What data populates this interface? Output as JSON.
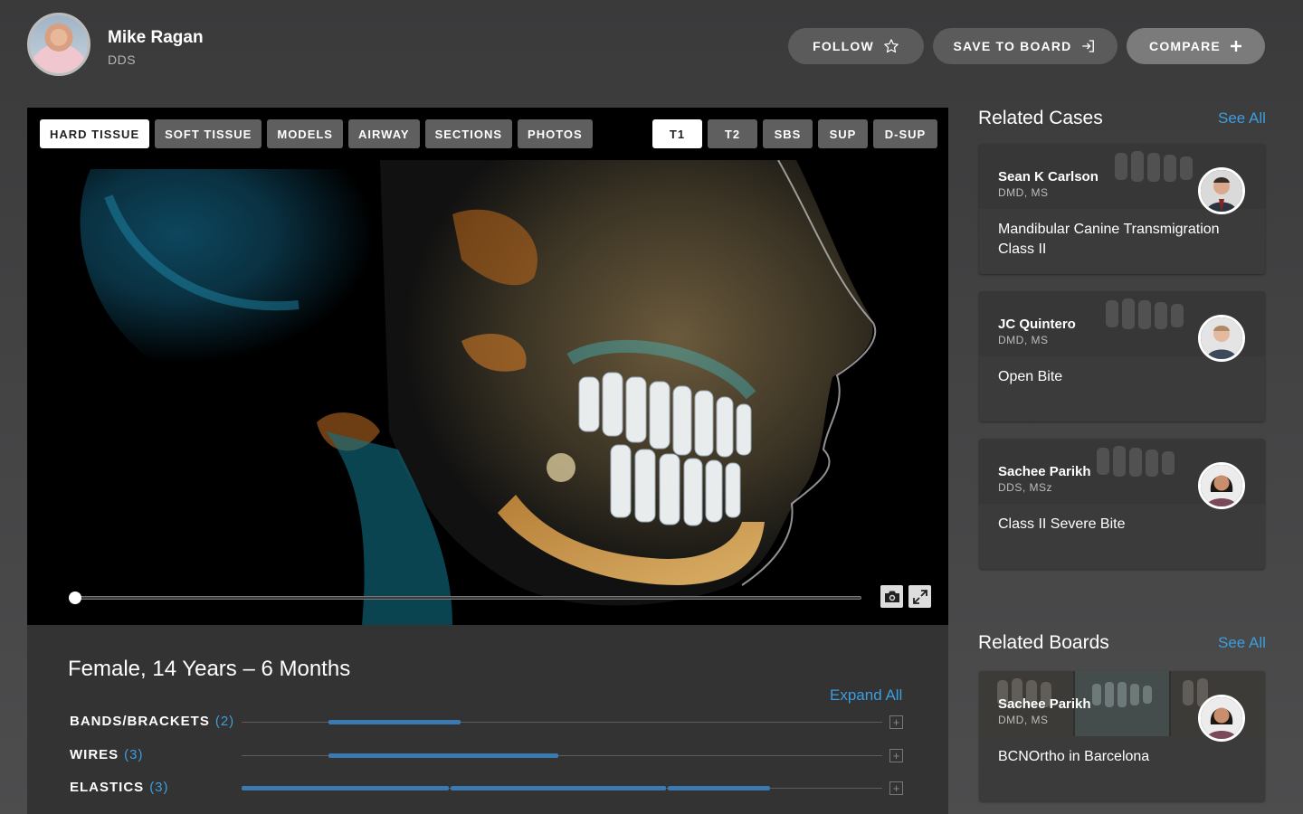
{
  "header": {
    "name": "Mike Ragan",
    "title": "DDS",
    "follow_label": "FOLLOW",
    "save_label": "SAVE TO BOARD",
    "compare_label": "COMPARE"
  },
  "viewer": {
    "tabs": [
      "HARD TISSUE",
      "SOFT TISSUE",
      "MODELS",
      "AIRWAY",
      "SECTIONS",
      "PHOTOS"
    ],
    "active_tab": "HARD TISSUE",
    "time_tabs": [
      "T1",
      "T2",
      "SBS",
      "SUP",
      "D-SUP"
    ],
    "active_time_tab": "T1",
    "slider_position": 0
  },
  "details": {
    "patient": "Female, 14 Years – 6 Months",
    "expand_label": "Expand All",
    "treatments": [
      {
        "label": "BANDS/BRACKETS",
        "count": "(2)"
      },
      {
        "label": "WIRES",
        "count": "(3)"
      },
      {
        "label": "ELASTICS",
        "count": "(3)"
      }
    ]
  },
  "related_cases": {
    "title": "Related Cases",
    "see_all": "See All",
    "cards": [
      {
        "name": "Sean K Carlson",
        "cred": "DMD, MS",
        "title": "Mandibular Canine Transmigration Class II"
      },
      {
        "name": "JC Quintero",
        "cred": "DMD, MS",
        "title": "Open Bite"
      },
      {
        "name": "Sachee Parikh",
        "cred": "DDS, MSz",
        "title": "Class II Severe Bite"
      }
    ]
  },
  "related_boards": {
    "title": "Related Boards",
    "see_all": "See All",
    "cards": [
      {
        "name": "Sachee Parikh",
        "cred": "DMD, MS",
        "title": "BCNOrtho in Barcelona"
      }
    ]
  },
  "colors": {
    "accent": "#3d9ddd",
    "bar": "#3b7ab1"
  }
}
